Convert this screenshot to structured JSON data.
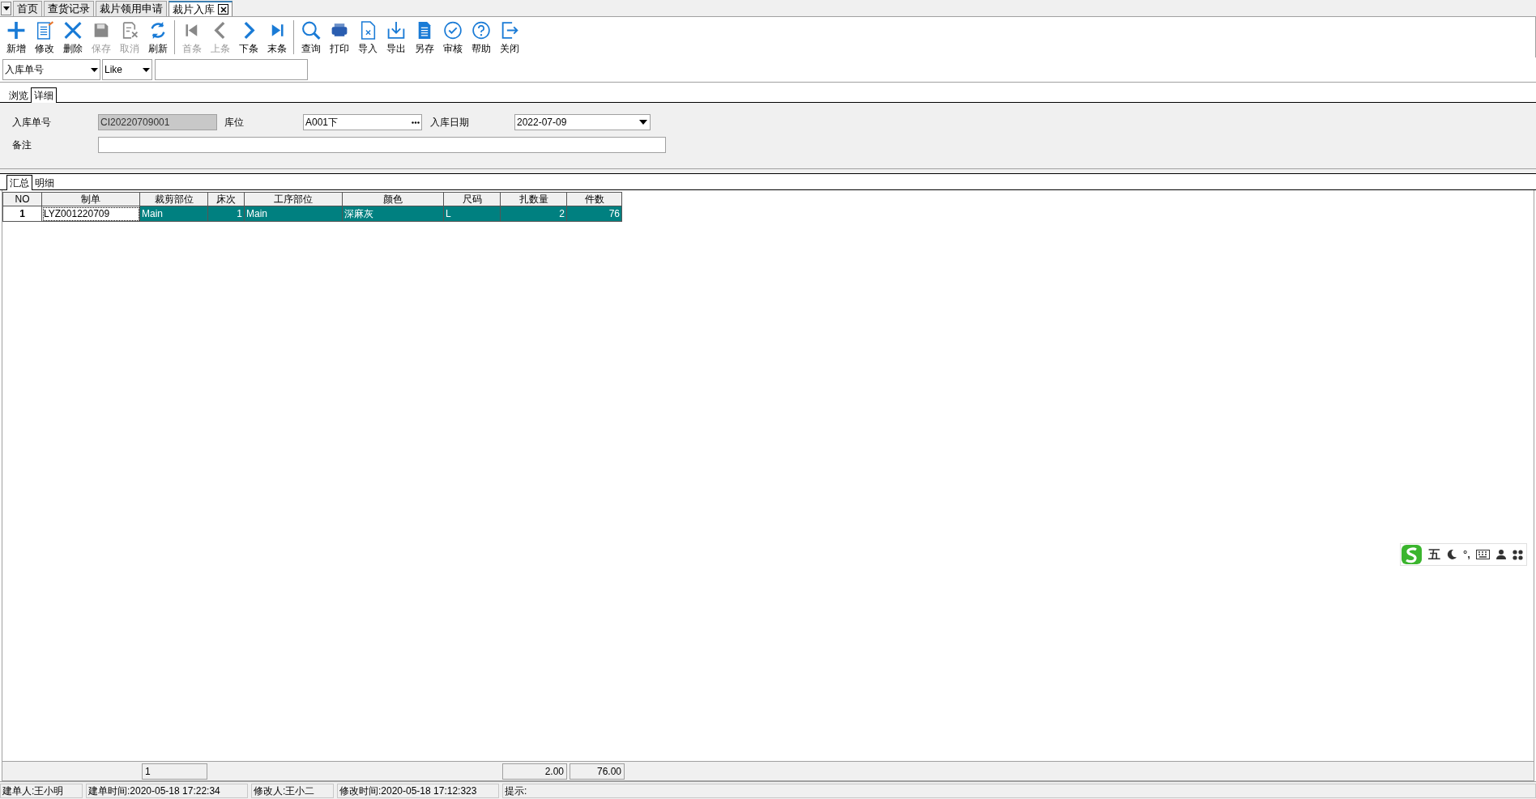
{
  "doc_tabs": [
    {
      "label": "首页",
      "selected": false
    },
    {
      "label": "查货记录",
      "selected": false
    },
    {
      "label": "裁片领用申请",
      "selected": false
    },
    {
      "label": "裁片入库",
      "selected": true
    }
  ],
  "toolbar": {
    "groups": [
      [
        {
          "label": "新增",
          "disabled": false
        },
        {
          "label": "修改",
          "disabled": false
        },
        {
          "label": "删除",
          "disabled": false
        },
        {
          "label": "保存",
          "disabled": true
        },
        {
          "label": "取消",
          "disabled": true
        },
        {
          "label": "刷新",
          "disabled": false
        }
      ],
      [
        {
          "label": "首条",
          "disabled": true
        },
        {
          "label": "上条",
          "disabled": true
        },
        {
          "label": "下条",
          "disabled": false
        },
        {
          "label": "末条",
          "disabled": false
        }
      ],
      [
        {
          "label": "查询",
          "disabled": false
        },
        {
          "label": "打印",
          "disabled": false
        },
        {
          "label": "导入",
          "disabled": false
        },
        {
          "label": "导出",
          "disabled": false
        },
        {
          "label": "另存",
          "disabled": false
        },
        {
          "label": "审核",
          "disabled": false
        },
        {
          "label": "帮助",
          "disabled": false
        },
        {
          "label": "关闭",
          "disabled": false
        }
      ]
    ]
  },
  "filter": {
    "field": "入库单号",
    "operator": "Like"
  },
  "view_tabs": [
    {
      "label": "浏览",
      "selected": false
    },
    {
      "label": "详细",
      "selected": true
    }
  ],
  "form": {
    "order_no_label": "入库单号",
    "order_no": "CI20220709001",
    "location_label": "库位",
    "location": "A001下",
    "date_label": "入库日期",
    "date": "2022-07-09",
    "remark_label": "备注"
  },
  "grid_tabs": [
    {
      "label": "汇总",
      "selected": true
    },
    {
      "label": "明细",
      "selected": false
    }
  ],
  "table": {
    "columns": [
      {
        "label": "NO",
        "kind": "index"
      },
      {
        "label": "制单",
        "kind": "text"
      },
      {
        "label": "裁剪部位",
        "kind": "text"
      },
      {
        "label": "床次",
        "kind": "number"
      },
      {
        "label": "工序部位",
        "kind": "text"
      },
      {
        "label": "颜色",
        "kind": "text"
      },
      {
        "label": "尺码",
        "kind": "text"
      },
      {
        "label": "扎数量",
        "kind": "number"
      },
      {
        "label": "件数",
        "kind": "number"
      }
    ],
    "rows": [
      {
        "selected": true,
        "cells": [
          {
            "text": "1",
            "focused": false
          },
          {
            "text": "LYZ001220709",
            "focused": true
          },
          {
            "text": "Main",
            "focused": false
          },
          {
            "text": "1",
            "focused": false
          },
          {
            "text": "Main",
            "focused": false
          },
          {
            "text": "深麻灰",
            "focused": false
          },
          {
            "text": "L",
            "focused": false
          },
          {
            "text": "2",
            "focused": false
          },
          {
            "text": "76",
            "focused": false
          }
        ]
      }
    ],
    "footer": {
      "count": "1",
      "bundles_total": "2.00",
      "pieces_total": "76.00"
    }
  },
  "status_bar": [
    "建单人:王小明",
    "建单时间:2020-05-18 17:22:34",
    "修改人:王小二",
    "修改时间:2020-05-18 17:12:323",
    "提示:"
  ],
  "ime_bar": {
    "mode": "五",
    "punct": "°,"
  }
}
